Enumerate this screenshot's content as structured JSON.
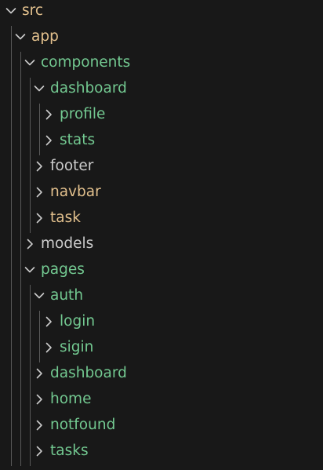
{
  "colors": {
    "background": "#181818",
    "chevron": "#cccccc",
    "guide": "#585858",
    "green": "#73c991",
    "orange": "#e2c08d",
    "default": "#cccccc"
  },
  "icons": {
    "expanded": "chevron-down-icon",
    "collapsed": "chevron-right-icon"
  },
  "tree": [
    {
      "name": "src",
      "depth": 0,
      "expanded": true,
      "status": "orange"
    },
    {
      "name": "app",
      "depth": 1,
      "expanded": true,
      "status": "orange"
    },
    {
      "name": "components",
      "depth": 2,
      "expanded": true,
      "status": "green"
    },
    {
      "name": "dashboard",
      "depth": 3,
      "expanded": true,
      "status": "green"
    },
    {
      "name": "profile",
      "depth": 4,
      "expanded": false,
      "status": "green"
    },
    {
      "name": "stats",
      "depth": 4,
      "expanded": false,
      "status": "green"
    },
    {
      "name": "footer",
      "depth": 3,
      "expanded": false,
      "status": "default"
    },
    {
      "name": "navbar",
      "depth": 3,
      "expanded": false,
      "status": "orange"
    },
    {
      "name": "task",
      "depth": 3,
      "expanded": false,
      "status": "orange"
    },
    {
      "name": "models",
      "depth": 2,
      "expanded": false,
      "status": "default"
    },
    {
      "name": "pages",
      "depth": 2,
      "expanded": true,
      "status": "green"
    },
    {
      "name": "auth",
      "depth": 3,
      "expanded": true,
      "status": "green"
    },
    {
      "name": "login",
      "depth": 4,
      "expanded": false,
      "status": "green"
    },
    {
      "name": "sigin",
      "depth": 4,
      "expanded": false,
      "status": "green"
    },
    {
      "name": "dashboard",
      "depth": 3,
      "expanded": false,
      "status": "green"
    },
    {
      "name": "home",
      "depth": 3,
      "expanded": false,
      "status": "green"
    },
    {
      "name": "notfound",
      "depth": 3,
      "expanded": false,
      "status": "green"
    },
    {
      "name": "tasks",
      "depth": 3,
      "expanded": false,
      "status": "green"
    }
  ]
}
